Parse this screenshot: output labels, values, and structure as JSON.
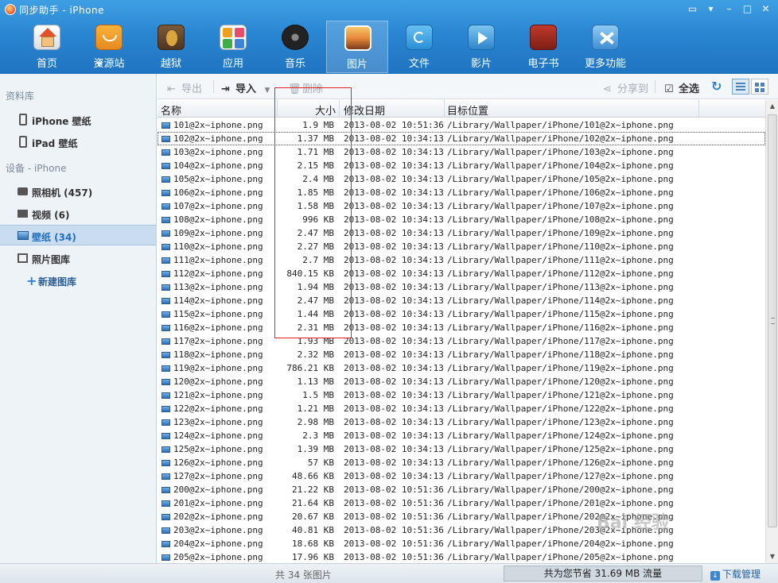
{
  "window": {
    "title": "同步助手 - iPhone",
    "controls": [
      "chat-icon",
      "skin-icon",
      "minimize-icon",
      "maximize-icon",
      "close-icon"
    ]
  },
  "nav": {
    "items": [
      {
        "label": "首页",
        "icon": "home-icon"
      },
      {
        "label": "资源站",
        "icon": "store-icon"
      },
      {
        "label": "越狱",
        "icon": "jailbreak-icon"
      },
      {
        "label": "应用",
        "icon": "apps-icon"
      },
      {
        "label": "音乐",
        "icon": "music-icon"
      },
      {
        "label": "图片",
        "icon": "photo-icon",
        "active": true
      },
      {
        "label": "文件",
        "icon": "folder-icon"
      },
      {
        "label": "影片",
        "icon": "video-icon"
      },
      {
        "label": "电子书",
        "icon": "ebook-icon"
      },
      {
        "label": "更多功能",
        "icon": "tools-icon"
      }
    ]
  },
  "sidebar": {
    "library_header": "资料库",
    "library_items": [
      {
        "label": "iPhone 壁纸"
      },
      {
        "label": "iPad 壁纸"
      }
    ],
    "device_header": "设备 - iPhone",
    "device_items": [
      {
        "label": "照相机 (457)",
        "icon": "camera-icon"
      },
      {
        "label": "视频 (6)",
        "icon": "film-icon"
      },
      {
        "label": "壁纸 (34)",
        "icon": "wallpaper-icon",
        "active": true
      },
      {
        "label": "照片图库",
        "icon": "album-icon"
      }
    ],
    "new_album": "新建图库"
  },
  "toolbar": {
    "export": "导出",
    "import": "导入",
    "delete": "删除",
    "share": "分享到",
    "select_all": "全选"
  },
  "table": {
    "columns": [
      "名称",
      "大小",
      "修改日期",
      "目标位置"
    ],
    "rows": [
      {
        "name": "101@2x~iphone.png",
        "size": "1.9 MB",
        "date": "2013-08-02 10:51:36",
        "path": "/Library/Wallpaper/iPhone/101@2x~iphone.png"
      },
      {
        "name": "102@2x~iphone.png",
        "size": "1.37 MB",
        "date": "2013-08-02 10:34:13",
        "path": "/Library/Wallpaper/iPhone/102@2x~iphone.png"
      },
      {
        "name": "103@2x~iphone.png",
        "size": "1.71 MB",
        "date": "2013-08-02 10:34:13",
        "path": "/Library/Wallpaper/iPhone/103@2x~iphone.png"
      },
      {
        "name": "104@2x~iphone.png",
        "size": "2.15 MB",
        "date": "2013-08-02 10:34:13",
        "path": "/Library/Wallpaper/iPhone/104@2x~iphone.png"
      },
      {
        "name": "105@2x~iphone.png",
        "size": "2.4 MB",
        "date": "2013-08-02 10:34:13",
        "path": "/Library/Wallpaper/iPhone/105@2x~iphone.png"
      },
      {
        "name": "106@2x~iphone.png",
        "size": "1.85 MB",
        "date": "2013-08-02 10:34:13",
        "path": "/Library/Wallpaper/iPhone/106@2x~iphone.png"
      },
      {
        "name": "107@2x~iphone.png",
        "size": "1.58 MB",
        "date": "2013-08-02 10:34:13",
        "path": "/Library/Wallpaper/iPhone/107@2x~iphone.png"
      },
      {
        "name": "108@2x~iphone.png",
        "size": "996 KB",
        "date": "2013-08-02 10:34:13",
        "path": "/Library/Wallpaper/iPhone/108@2x~iphone.png"
      },
      {
        "name": "109@2x~iphone.png",
        "size": "2.47 MB",
        "date": "2013-08-02 10:34:13",
        "path": "/Library/Wallpaper/iPhone/109@2x~iphone.png"
      },
      {
        "name": "110@2x~iphone.png",
        "size": "2.27 MB",
        "date": "2013-08-02 10:34:13",
        "path": "/Library/Wallpaper/iPhone/110@2x~iphone.png"
      },
      {
        "name": "111@2x~iphone.png",
        "size": "2.7 MB",
        "date": "2013-08-02 10:34:13",
        "path": "/Library/Wallpaper/iPhone/111@2x~iphone.png"
      },
      {
        "name": "112@2x~iphone.png",
        "size": "840.15 KB",
        "date": "2013-08-02 10:34:13",
        "path": "/Library/Wallpaper/iPhone/112@2x~iphone.png"
      },
      {
        "name": "113@2x~iphone.png",
        "size": "1.94 MB",
        "date": "2013-08-02 10:34:13",
        "path": "/Library/Wallpaper/iPhone/113@2x~iphone.png"
      },
      {
        "name": "114@2x~iphone.png",
        "size": "2.47 MB",
        "date": "2013-08-02 10:34:13",
        "path": "/Library/Wallpaper/iPhone/114@2x~iphone.png"
      },
      {
        "name": "115@2x~iphone.png",
        "size": "1.44 MB",
        "date": "2013-08-02 10:34:13",
        "path": "/Library/Wallpaper/iPhone/115@2x~iphone.png"
      },
      {
        "name": "116@2x~iphone.png",
        "size": "2.31 MB",
        "date": "2013-08-02 10:34:13",
        "path": "/Library/Wallpaper/iPhone/116@2x~iphone.png"
      },
      {
        "name": "117@2x~iphone.png",
        "size": "1.93 MB",
        "date": "2013-08-02 10:34:13",
        "path": "/Library/Wallpaper/iPhone/117@2x~iphone.png"
      },
      {
        "name": "118@2x~iphone.png",
        "size": "2.32 MB",
        "date": "2013-08-02 10:34:13",
        "path": "/Library/Wallpaper/iPhone/118@2x~iphone.png"
      },
      {
        "name": "119@2x~iphone.png",
        "size": "786.21 KB",
        "date": "2013-08-02 10:34:13",
        "path": "/Library/Wallpaper/iPhone/119@2x~iphone.png"
      },
      {
        "name": "120@2x~iphone.png",
        "size": "1.13 MB",
        "date": "2013-08-02 10:34:13",
        "path": "/Library/Wallpaper/iPhone/120@2x~iphone.png"
      },
      {
        "name": "121@2x~iphone.png",
        "size": "1.5 MB",
        "date": "2013-08-02 10:34:13",
        "path": "/Library/Wallpaper/iPhone/121@2x~iphone.png"
      },
      {
        "name": "122@2x~iphone.png",
        "size": "1.21 MB",
        "date": "2013-08-02 10:34:13",
        "path": "/Library/Wallpaper/iPhone/122@2x~iphone.png"
      },
      {
        "name": "123@2x~iphone.png",
        "size": "2.98 MB",
        "date": "2013-08-02 10:34:13",
        "path": "/Library/Wallpaper/iPhone/123@2x~iphone.png"
      },
      {
        "name": "124@2x~iphone.png",
        "size": "2.3 MB",
        "date": "2013-08-02 10:34:13",
        "path": "/Library/Wallpaper/iPhone/124@2x~iphone.png"
      },
      {
        "name": "125@2x~iphone.png",
        "size": "1.39 MB",
        "date": "2013-08-02 10:34:13",
        "path": "/Library/Wallpaper/iPhone/125@2x~iphone.png"
      },
      {
        "name": "126@2x~iphone.png",
        "size": "57 KB",
        "date": "2013-08-02 10:34:13",
        "path": "/Library/Wallpaper/iPhone/126@2x~iphone.png"
      },
      {
        "name": "127@2x~iphone.png",
        "size": "48.66 KB",
        "date": "2013-08-02 10:34:13",
        "path": "/Library/Wallpaper/iPhone/127@2x~iphone.png"
      },
      {
        "name": "200@2x~iphone.png",
        "size": "21.22 KB",
        "date": "2013-08-02 10:51:36",
        "path": "/Library/Wallpaper/iPhone/200@2x~iphone.png"
      },
      {
        "name": "201@2x~iphone.png",
        "size": "21.64 KB",
        "date": "2013-08-02 10:51:36",
        "path": "/Library/Wallpaper/iPhone/201@2x~iphone.png"
      },
      {
        "name": "202@2x~iphone.png",
        "size": "20.67 KB",
        "date": "2013-08-02 10:51:36",
        "path": "/Library/Wallpaper/iPhone/202@2x~iphone.png"
      },
      {
        "name": "203@2x~iphone.png",
        "size": "40.81 KB",
        "date": "2013-08-02 10:51:36",
        "path": "/Library/Wallpaper/iPhone/203@2x~iphone.png"
      },
      {
        "name": "204@2x~iphone.png",
        "size": "18.68 KB",
        "date": "2013-08-02 10:51:36",
        "path": "/Library/Wallpaper/iPhone/204@2x~iphone.png"
      },
      {
        "name": "205@2x~iphone.png",
        "size": "17.96 KB",
        "date": "2013-08-02 10:51:36",
        "path": "/Library/Wallpaper/iPhone/205@2x~iphone.png"
      }
    ]
  },
  "status": {
    "count": "共 34 张图片",
    "saved": "共为您节省  31.69 MB 流量",
    "download": "下载管理"
  },
  "watermark": "Bai 经验",
  "colors": {
    "header": "#2a86d2",
    "sidebar_bg": "#eef3f8",
    "selected": "#c9dcf0",
    "highlight": "#e0202a"
  }
}
